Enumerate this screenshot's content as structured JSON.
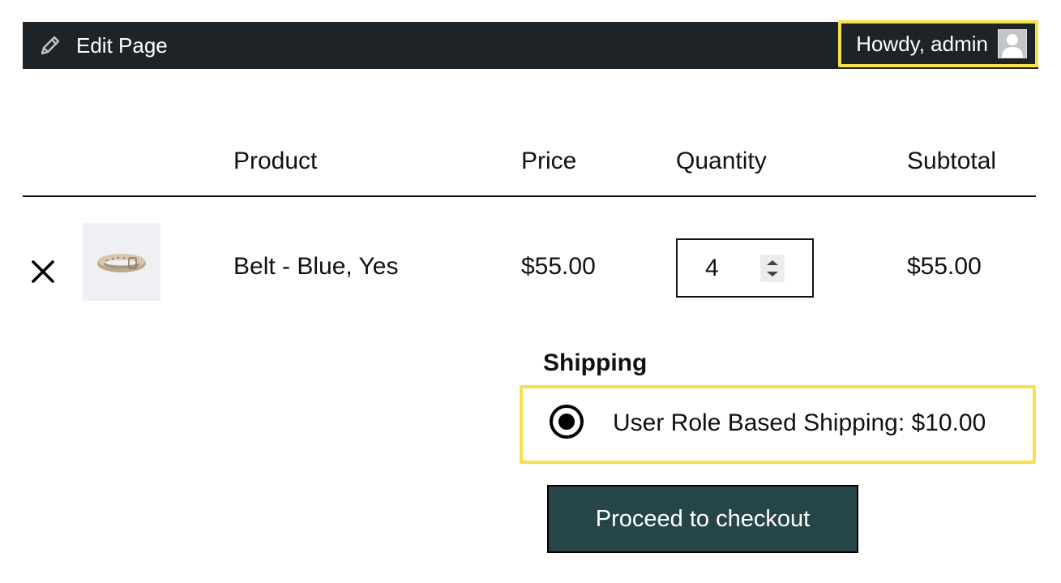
{
  "admin_bar": {
    "edit_label": "Edit Page",
    "greeting": "Howdy, admin",
    "edit_icon": "pencil-icon",
    "avatar_icon": "user-avatar-icon",
    "background": "#1d2327",
    "highlight_color": "#f6e04b"
  },
  "cart": {
    "columns": [
      "Product",
      "Price",
      "Quantity",
      "Subtotal"
    ],
    "items": [
      {
        "name": "Belt - Blue, Yes",
        "price": "$55.00",
        "quantity": "4",
        "subtotal": "$55.00",
        "remove_icon": "close-icon",
        "thumbnail": "belt-thumbnail"
      }
    ]
  },
  "shipping": {
    "title": "Shipping",
    "option_label": "User Role Based Shipping: $10.00",
    "selected": true
  },
  "checkout": {
    "label": "Proceed to checkout",
    "background": "#264548"
  }
}
